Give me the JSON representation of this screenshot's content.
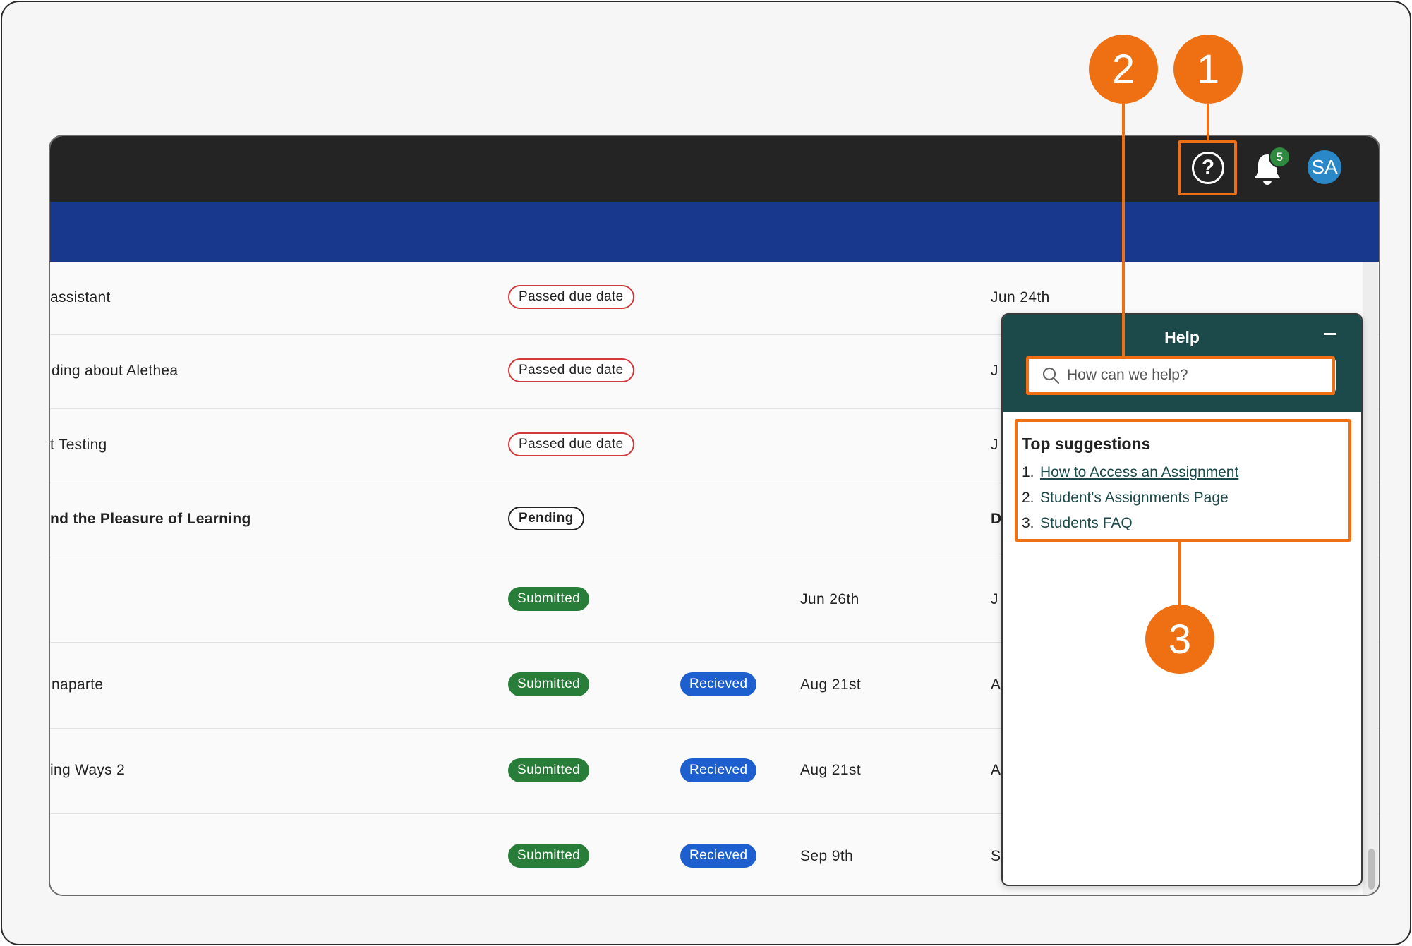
{
  "header": {
    "notification_count": "5",
    "avatar_initials": "SA"
  },
  "assignments": [
    {
      "title": "assistant",
      "status": "Passed due date",
      "status_type": "passed",
      "due": "Jun 24th",
      "due_cut": ""
    },
    {
      "title": "ding about Alethea",
      "status": "Passed due date",
      "status_type": "passed",
      "due_cut": "J"
    },
    {
      "title": "t Testing",
      "status": "Passed due date",
      "status_type": "passed",
      "due_cut": "J"
    },
    {
      "title": "nd the Pleasure of Learning",
      "status": "Pending",
      "status_type": "pending",
      "due_cut": "D"
    },
    {
      "title": "",
      "status": "Submitted",
      "status_type": "submitted",
      "submitted_date": "Jun 26th",
      "due_cut": "J"
    },
    {
      "title": "naparte",
      "status": "Submitted",
      "status_type": "submitted",
      "grade_status": "Recieved",
      "submitted_date": "Aug 21st",
      "due_cut": "A"
    },
    {
      "title": "ing Ways 2",
      "status": "Submitted",
      "status_type": "submitted",
      "grade_status": "Recieved",
      "submitted_date": "Aug 21st",
      "due_cut": "A"
    },
    {
      "title": "",
      "status": "Submitted",
      "status_type": "submitted",
      "grade_status": "Recieved",
      "submitted_date": "Sep 9th",
      "due_cut": "S"
    }
  ],
  "help_panel": {
    "title": "Help",
    "search_placeholder": "How can we help?",
    "suggestions_title": "Top suggestions",
    "suggestions": [
      {
        "num": "1.",
        "label": "How to Access an Assignment"
      },
      {
        "num": "2.",
        "label": "Student's Assignments Page"
      },
      {
        "num": "3.",
        "label": "Students FAQ"
      }
    ]
  },
  "annotations": {
    "callout_1": "1",
    "callout_2": "2",
    "callout_3": "3",
    "accent_color": "#ee7012"
  },
  "colors": {
    "topbar": "#242424",
    "bluebar": "#17388c",
    "help_header": "#1c4a4a",
    "submitted": "#287d38",
    "received": "#1e5fd0",
    "passed_border": "#d23a3a"
  }
}
